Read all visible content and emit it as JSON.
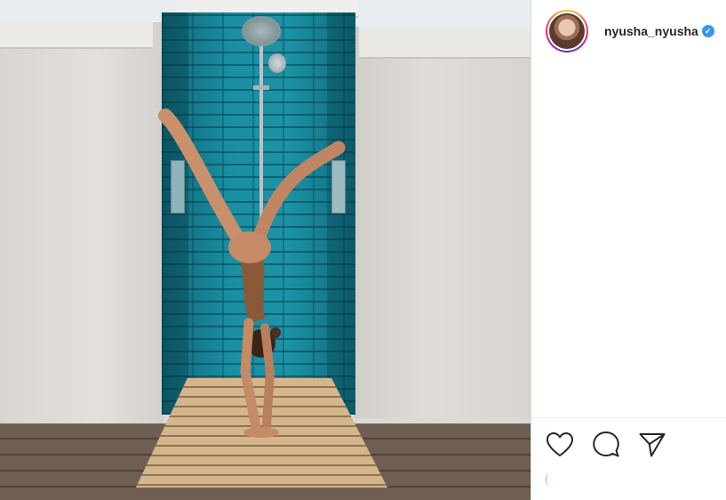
{
  "post": {
    "author": {
      "username": "nyusha_nyusha",
      "verified": true,
      "verified_badge_color": "#3897f0",
      "avatar_icon": "profile-photo"
    },
    "actions": {
      "like_icon": "heart-outline-icon",
      "comment_icon": "speech-bubble-icon",
      "share_icon": "paper-plane-icon"
    }
  },
  "colors": {
    "tile_accent": "#14798a",
    "story_ring": [
      "#f9ce34",
      "#ee2a7b",
      "#6228d7"
    ],
    "icon_stroke": "#262626"
  }
}
